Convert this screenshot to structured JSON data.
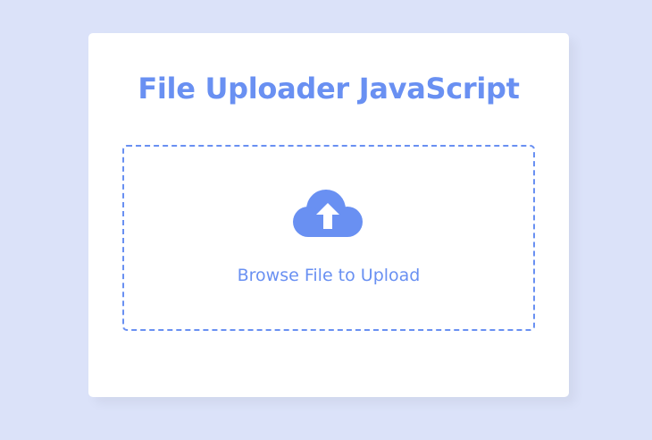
{
  "uploader": {
    "title": "File Uploader JavaScript",
    "browse_label": "Browse File to Upload",
    "icon": "cloud-upload-icon"
  },
  "theme": {
    "background": "#dbe2f9",
    "card": "#ffffff",
    "accent": "#6990f2"
  }
}
